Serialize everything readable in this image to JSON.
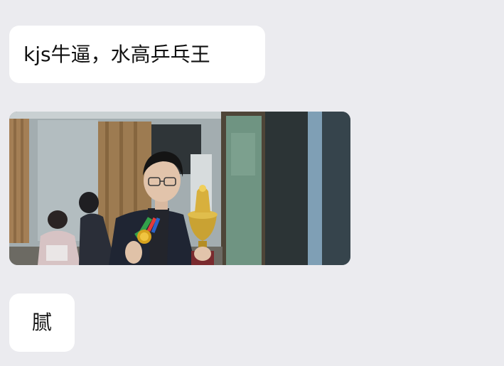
{
  "chat": {
    "messages": [
      {
        "type": "text",
        "text": "kjs牛逼，水高乒乓王"
      },
      {
        "type": "image",
        "subject": "photo"
      },
      {
        "type": "text",
        "text": "腻"
      }
    ]
  },
  "theme": {
    "background": "#ebebef",
    "bubble_bg": "#ffffff",
    "text_color": "#111111"
  }
}
